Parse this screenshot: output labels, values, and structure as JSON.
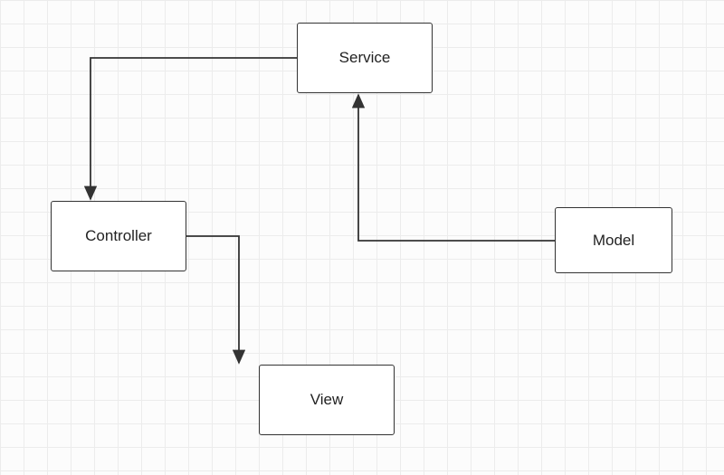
{
  "nodes": {
    "service": {
      "label": "Service"
    },
    "controller": {
      "label": "Controller"
    },
    "model": {
      "label": "Model"
    },
    "view": {
      "label": "View"
    }
  }
}
